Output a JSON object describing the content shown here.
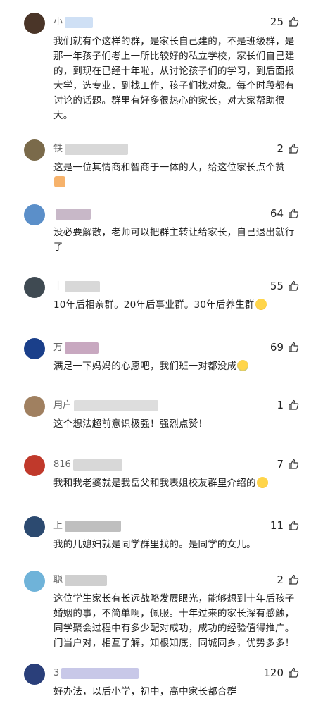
{
  "comments": [
    {
      "username": "小",
      "likes": "25",
      "lines": [
        "我们就有个这样的群，是家长自己建的，不是班级群，是",
        "那一年孩子们考上一所比较好的私立学校，家长们自己建",
        "的，到现在已经十年啦，从讨论孩子们的学习，到后面报",
        "大学，选专业，到找工作，孩子们找对象。每个时段都有",
        "讨论的话题。群里有好多很热心的家长，对大家帮助很",
        "大。"
      ],
      "avatar_color": "#4a3528"
    },
    {
      "username": "铁",
      "likes": "2",
      "lines": [
        "这是一位其情商和智商于一体的人，给这位家长点个赞"
      ],
      "emoji": "thumbs-up-emoji",
      "avatar_color": "#7a6a4a"
    },
    {
      "username": "",
      "likes": "64",
      "lines": [
        "没必要解散，老师可以把群主转让给家长，自己退出就行",
        "了"
      ],
      "avatar_color": "#5b8fc9"
    },
    {
      "username": "十",
      "likes": "55",
      "lines": [
        "10年后相亲群。20年后事业群。30年后养生群"
      ],
      "emoji": "laughing-emoji",
      "avatar_color": "#3f4a52"
    },
    {
      "username": "万",
      "likes": "69",
      "lines": [
        "满足一下妈妈的心愿吧，我们班一对都没成"
      ],
      "emoji": "crying-laughing-emoji",
      "avatar_color": "#1a3f8a"
    },
    {
      "username": "用户",
      "likes": "1",
      "lines": [
        "这个想法超前意识极强！强烈点赞！"
      ],
      "avatar_color": "#a08060"
    },
    {
      "username": "816",
      "likes": "7",
      "lines": [
        "我和我老婆就是我岳父和我表姐校友群里介绍的"
      ],
      "emoji": "rofl-emoji",
      "avatar_color": "#c0392b"
    },
    {
      "username": "上",
      "likes": "11",
      "lines": [
        "我的儿媳妇就是同学群里找的。是同学的女儿。"
      ],
      "avatar_color": "#2c4a70"
    },
    {
      "username": "聪",
      "likes": "2",
      "lines": [
        "这位学生家长有长远战略发展眼光，能够想到十年后孩子",
        "婚姻的事，不简单啊，佩服。十年过来的家长深有感触，",
        "同学聚会过程中有多少配对成功，成功的经验值得推广。",
        "门当户对，相互了解，知根知底，同城同乡，优势多多！"
      ],
      "avatar_color": "#6fb3d9"
    },
    {
      "username": "3",
      "likes": "120",
      "lines": [
        "好办法，以后小学，初中，高中家长都合群"
      ],
      "avatar_color": "#2a3f7a"
    }
  ],
  "colors": {
    "text": "#222222",
    "muted": "#666666",
    "divider": "#f0f0f0"
  }
}
